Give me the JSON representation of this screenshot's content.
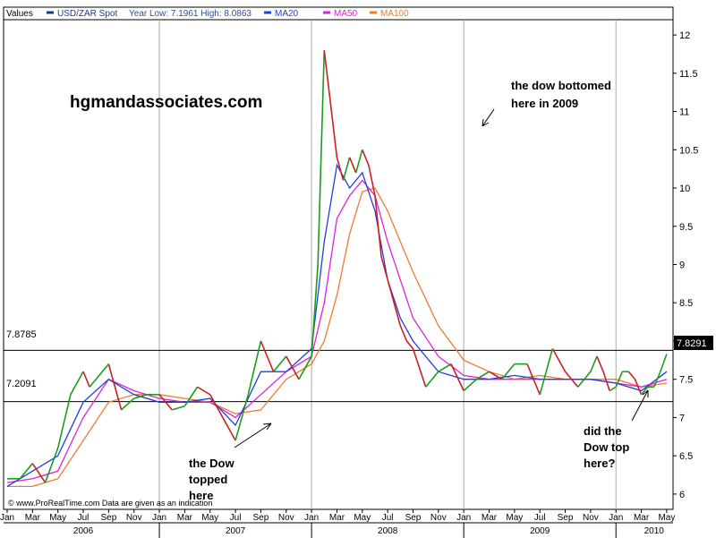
{
  "chart_data": {
    "type": "line",
    "legend": {
      "values_label": "Values",
      "items": [
        {
          "label": "USD/ZAR Spot",
          "color": "#1a3a8c"
        },
        {
          "label": "Year Low: 7.1961 High: 8.0863",
          "color": "#2a4ea0"
        },
        {
          "label": "MA20",
          "color": "#1f3fe0"
        },
        {
          "label": "MA50",
          "color": "#e020e0"
        },
        {
          "label": "MA100",
          "color": "#f07a30"
        }
      ]
    },
    "y_axis": {
      "min": 5.8,
      "max": 12.2,
      "ticks": [
        "12",
        "11.5",
        "11",
        "10.5",
        "10",
        "9.5",
        "9",
        "8.5",
        "8",
        "7.5",
        "7",
        "6.5",
        "6"
      ]
    },
    "x_axis": {
      "min": 0,
      "max": 52.5,
      "months": [
        "Jan",
        "Mar",
        "May",
        "Jul",
        "Sep",
        "Nov",
        "Jan",
        "Mar",
        "May",
        "Jul",
        "Sep",
        "Nov",
        "Jan",
        "Mar",
        "May",
        "Jul",
        "Sep",
        "Nov",
        "Jan",
        "Mar",
        "May",
        "Jul",
        "Sep",
        "Nov",
        "Jan",
        "Mar",
        "May"
      ],
      "years": [
        "2006",
        "2007",
        "2008",
        "2009",
        "2010"
      ]
    },
    "reference_lines": [
      {
        "value": 7.8785,
        "label": "7.8785"
      },
      {
        "value": 7.2091,
        "label": "7.2091"
      }
    ],
    "last_value": {
      "value": 7.8291,
      "label": "7.8291"
    },
    "series": [
      {
        "key": "spot",
        "name": "USD/ZAR Spot",
        "x": [
          0,
          1,
          2,
          3,
          4,
          5,
          6,
          6.5,
          7,
          8,
          9,
          10,
          11,
          12,
          13,
          14,
          15,
          16,
          17,
          18,
          19,
          20,
          21,
          22,
          23,
          24,
          24.5,
          25,
          26,
          26.5,
          27,
          27.5,
          28,
          28.5,
          29,
          29.5,
          30,
          30.5,
          31,
          31.5,
          32,
          33,
          34,
          35,
          36,
          37,
          38,
          39,
          40,
          41,
          42,
          43,
          44,
          45,
          46,
          46.5,
          47,
          47.5,
          48,
          48.5,
          49,
          49.5,
          50,
          50.5,
          51,
          51.5,
          52
        ],
        "y": [
          6.2,
          6.2,
          6.4,
          6.15,
          6.6,
          7.3,
          7.6,
          7.4,
          7.5,
          7.7,
          7.1,
          7.25,
          7.3,
          7.3,
          7.1,
          7.15,
          7.4,
          7.3,
          7.0,
          6.7,
          7.3,
          8.0,
          7.6,
          7.8,
          7.5,
          7.8,
          9.0,
          11.8,
          10.4,
          10.1,
          10.4,
          10.2,
          10.5,
          10.3,
          9.9,
          9.1,
          8.8,
          8.5,
          8.2,
          8.0,
          7.9,
          7.4,
          7.6,
          7.7,
          7.35,
          7.5,
          7.6,
          7.5,
          7.7,
          7.7,
          7.3,
          7.9,
          7.6,
          7.4,
          7.6,
          7.8,
          7.6,
          7.35,
          7.4,
          7.6,
          7.6,
          7.5,
          7.3,
          7.4,
          7.4,
          7.6,
          7.83
        ]
      },
      {
        "key": "ma20",
        "name": "MA20",
        "x": [
          0,
          2,
          4,
          6,
          8,
          10,
          12,
          14,
          16,
          18,
          20,
          22,
          24,
          25,
          26,
          27,
          28,
          29,
          30,
          31,
          32,
          34,
          36,
          38,
          40,
          42,
          44,
          46,
          48,
          50,
          52
        ],
        "y": [
          6.1,
          6.3,
          6.5,
          7.2,
          7.5,
          7.3,
          7.2,
          7.2,
          7.25,
          6.9,
          7.6,
          7.6,
          7.9,
          9.3,
          10.3,
          10.0,
          10.2,
          9.7,
          8.8,
          8.3,
          8.0,
          7.6,
          7.5,
          7.5,
          7.55,
          7.5,
          7.5,
          7.5,
          7.45,
          7.35,
          7.6
        ]
      },
      {
        "key": "ma50",
        "name": "MA50",
        "x": [
          0,
          2,
          4,
          6,
          8,
          10,
          12,
          14,
          16,
          18,
          20,
          22,
          24,
          25,
          26,
          27,
          28,
          29,
          30,
          31,
          32,
          34,
          36,
          38,
          40,
          42,
          44,
          46,
          48,
          50,
          52
        ],
        "y": [
          6.15,
          6.2,
          6.3,
          7.0,
          7.5,
          7.35,
          7.25,
          7.2,
          7.2,
          7.0,
          7.3,
          7.6,
          7.8,
          8.5,
          9.6,
          9.9,
          10.1,
          9.9,
          9.3,
          8.8,
          8.3,
          7.8,
          7.55,
          7.5,
          7.5,
          7.5,
          7.5,
          7.5,
          7.45,
          7.4,
          7.5
        ]
      },
      {
        "key": "ma100",
        "name": "MA100",
        "x": [
          0,
          2,
          4,
          6,
          8,
          10,
          12,
          14,
          16,
          18,
          20,
          22,
          24,
          25,
          26,
          27,
          28,
          29,
          30,
          31,
          32,
          34,
          36,
          38,
          40,
          42,
          44,
          46,
          48,
          50,
          52
        ],
        "y": [
          6.1,
          6.1,
          6.2,
          6.7,
          7.2,
          7.3,
          7.3,
          7.25,
          7.2,
          7.05,
          7.1,
          7.5,
          7.7,
          8.0,
          8.6,
          9.4,
          9.95,
          10.0,
          9.7,
          9.3,
          8.9,
          8.2,
          7.75,
          7.6,
          7.5,
          7.55,
          7.5,
          7.5,
          7.5,
          7.4,
          7.45
        ]
      }
    ],
    "series_colors": {
      "spot_up": "#1c9c1c",
      "spot_down": "#cc1f1f",
      "ma20": "#1f3fe0",
      "ma50": "#e020e0",
      "ma100": "#f07a30"
    },
    "annotations": [
      {
        "key": "watermark",
        "lines": [
          "hgmandassociates.com"
        ]
      },
      {
        "key": "dow_bottomed",
        "lines": [
          "the dow bottomed",
          "here in 2009"
        ]
      },
      {
        "key": "dow_topped",
        "lines": [
          "the Dow",
          "topped",
          "here"
        ]
      },
      {
        "key": "dow_top_2010",
        "lines": [
          "did the",
          "Dow top",
          "here?"
        ]
      }
    ],
    "footer": "© www.ProRealTime.com Data are given as an indication"
  }
}
